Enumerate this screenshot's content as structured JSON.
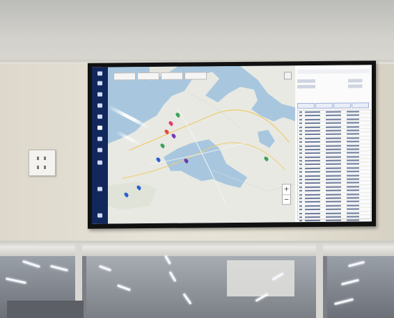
{
  "scene": {
    "description_tags": [
      "ceiling",
      "wall",
      "wall-outlet",
      "wall-mounted-tv",
      "glass-partition"
    ]
  },
  "screen": {
    "sidebar_bottom_text": "",
    "map_tabs": [
      "",
      "",
      "",
      ""
    ],
    "zoom": {
      "in": "+",
      "out": "−"
    },
    "colors": {
      "sidebar": "#12285c",
      "sea": "#a8c7df",
      "land": "#e8e9e3",
      "panel": "#fbfbfb",
      "accent": "#2b4a90"
    }
  }
}
